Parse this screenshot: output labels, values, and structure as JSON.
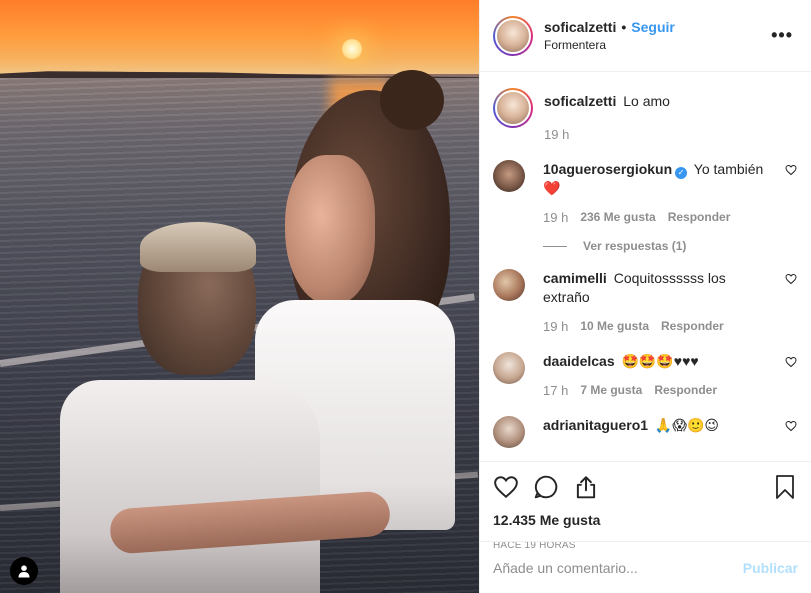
{
  "header": {
    "username": "soficalzetti",
    "separator": "•",
    "follow_label": "Seguir",
    "location": "Formentera",
    "more_glyph": "•••"
  },
  "caption": {
    "username": "soficalzetti",
    "text": "Lo amo",
    "time": "19 h"
  },
  "comments": [
    {
      "username": "10aguerosergiokun",
      "verified": true,
      "text": "Yo también",
      "emoji": "❤️",
      "time": "19 h",
      "likes": "236 Me gusta",
      "reply": "Responder",
      "view_replies": "Ver respuestas (1)"
    },
    {
      "username": "camimelli",
      "text": "Coquitossssss los extraño",
      "time": "19 h",
      "likes": "10 Me gusta",
      "reply": "Responder"
    },
    {
      "username": "daaidelcas",
      "text": "🤩🤩🤩♥♥♥",
      "time": "17 h",
      "likes": "7 Me gusta",
      "reply": "Responder"
    },
    {
      "username": "adrianitaguero1",
      "text": "🙏😱🙂😉"
    }
  ],
  "footer": {
    "likes_total": "12.435 Me gusta",
    "timestamp": "HACE 19 HORAS",
    "comment_placeholder": "Añade un comentario...",
    "publish_label": "Publicar"
  },
  "colors": {
    "link_blue": "#3897f0",
    "publish_disabled": "#b2dffc",
    "muted": "#8e8e8e",
    "heart_red": "#ed4956"
  },
  "icons": [
    "more-icon",
    "heart-icon",
    "comment-icon",
    "share-icon",
    "bookmark-icon",
    "user-tag-icon",
    "verified-icon",
    "small-heart-icon"
  ]
}
